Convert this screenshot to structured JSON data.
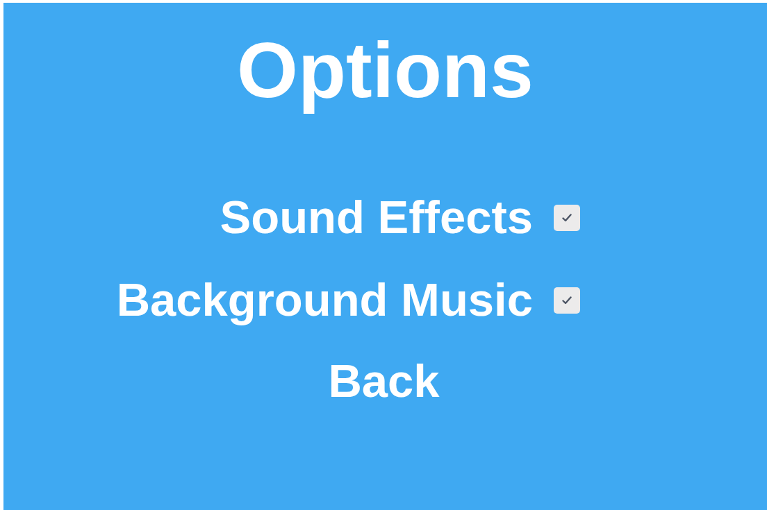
{
  "title": "Options",
  "options": [
    {
      "label": "Sound Effects",
      "checked": true
    },
    {
      "label": "Background Music",
      "checked": true
    }
  ],
  "back_button": {
    "label": "Back"
  }
}
